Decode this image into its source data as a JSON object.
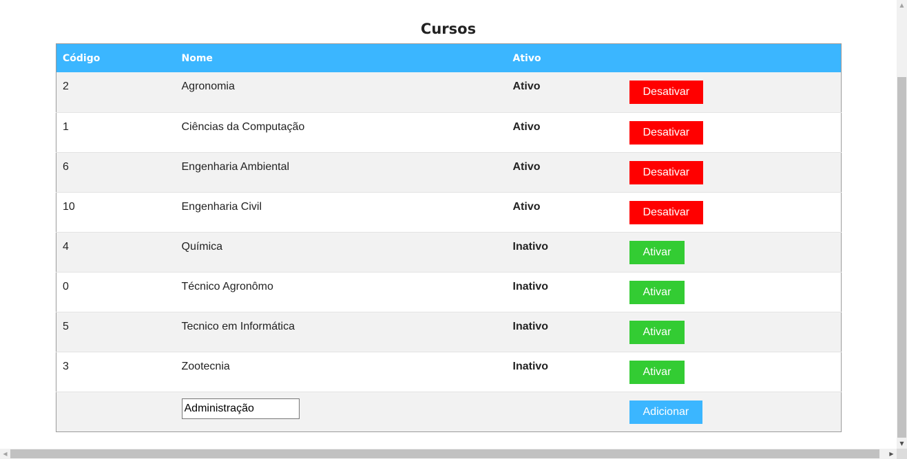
{
  "page": {
    "title": "Cursos"
  },
  "table": {
    "headers": {
      "code": "Código",
      "name": "Nome",
      "active": "Ativo",
      "actions": ""
    },
    "rows": [
      {
        "code": "2",
        "name": "Agronomia",
        "status": "Ativo",
        "active": true,
        "action": "Desativar"
      },
      {
        "code": "1",
        "name": "Ciências da Computação",
        "status": "Ativo",
        "active": true,
        "action": "Desativar"
      },
      {
        "code": "6",
        "name": "Engenharia Ambiental",
        "status": "Ativo",
        "active": true,
        "action": "Desativar"
      },
      {
        "code": "10",
        "name": "Engenharia Civil",
        "status": "Ativo",
        "active": true,
        "action": "Desativar"
      },
      {
        "code": "4",
        "name": "Química",
        "status": "Inativo",
        "active": false,
        "action": "Ativar"
      },
      {
        "code": "0",
        "name": "Técnico Agronômo",
        "status": "Inativo",
        "active": false,
        "action": "Ativar"
      },
      {
        "code": "5",
        "name": "Tecnico em Informática",
        "status": "Inativo",
        "active": false,
        "action": "Ativar"
      },
      {
        "code": "3",
        "name": "Zootecnia",
        "status": "Inativo",
        "active": false,
        "action": "Ativar"
      }
    ],
    "add_row": {
      "input_value": "Administração",
      "button_label": "Adicionar"
    }
  },
  "colors": {
    "header_bg": "#3bb6ff",
    "active_text": "#0a7a0a",
    "inactive_text": "#ee1111",
    "deactivate_button": "#ff0000",
    "activate_button": "#33cc33",
    "add_button": "#3bb6ff",
    "row_alt_bg": "#f2f2f2"
  },
  "icons": {
    "scroll_up": "▲",
    "scroll_down": "▼",
    "scroll_left": "◀",
    "scroll_right": "▶"
  }
}
